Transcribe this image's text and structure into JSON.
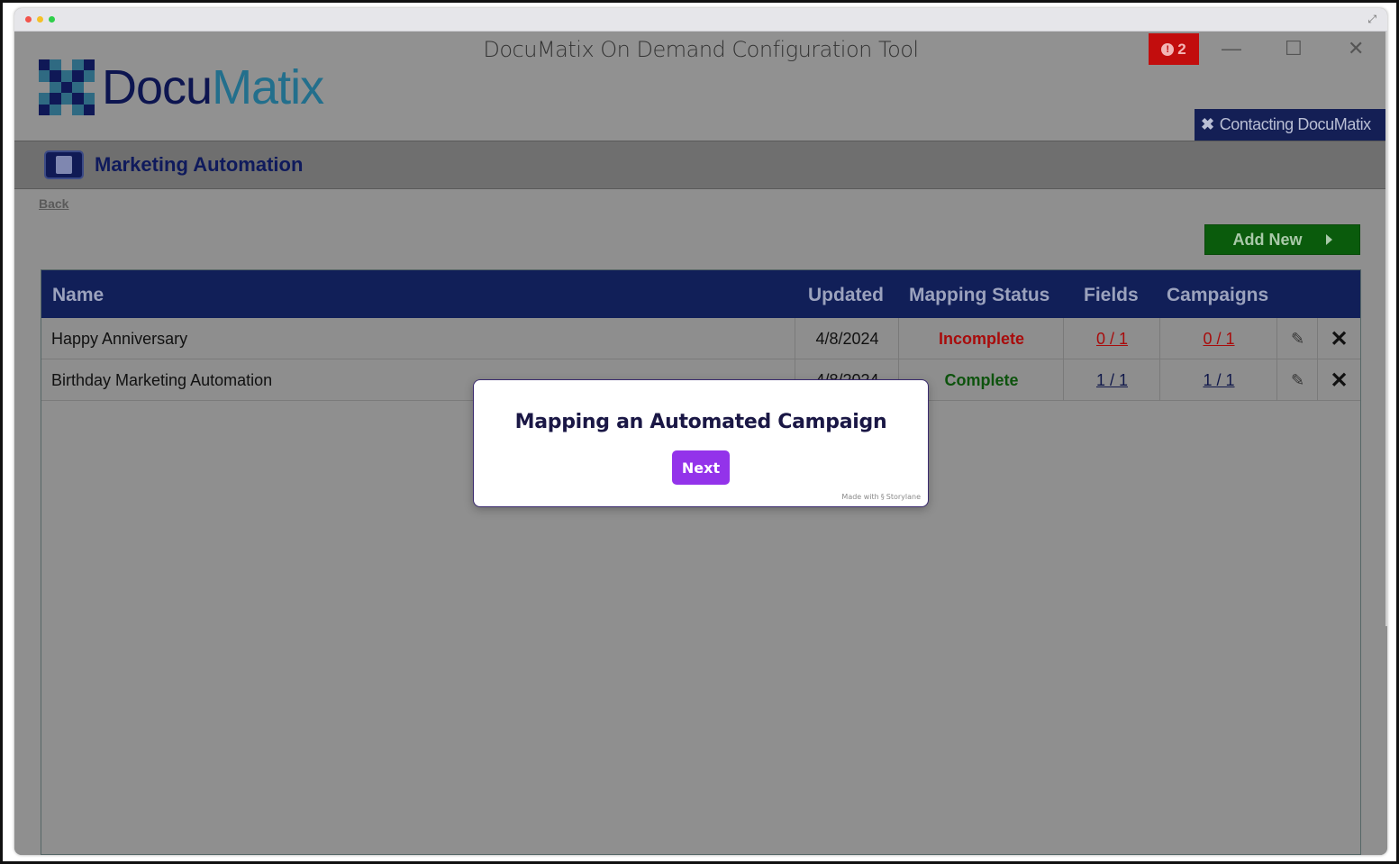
{
  "window": {
    "title": "DocuMatix On Demand Configuration Tool",
    "alert_count": "2"
  },
  "logo": {
    "docu": "Docu",
    "matix": "Matix"
  },
  "header": {
    "contact_label": "Contacting DocuMatix"
  },
  "section": {
    "title": "Marketing Automation"
  },
  "nav": {
    "back_label": "Back"
  },
  "toolbar": {
    "add_new_label": "Add New"
  },
  "table": {
    "columns": {
      "name": "Name",
      "updated": "Updated",
      "mapping_status": "Mapping Status",
      "fields": "Fields",
      "campaigns": "Campaigns"
    },
    "rows": [
      {
        "name": "Happy Anniversary",
        "updated": "4/8/2024",
        "mapping_status": "Incomplete",
        "fields": "0 / 1",
        "campaigns": "0 / 1"
      },
      {
        "name": "Birthday Marketing Automation",
        "updated": "4/8/2024",
        "mapping_status": "Complete",
        "fields": "1 / 1",
        "campaigns": "1 / 1"
      }
    ]
  },
  "modal": {
    "title": "Mapping an Automated Campaign",
    "next_label": "Next",
    "made_with": "Made with",
    "brand": "Storylane"
  },
  "colors": {
    "navy": "#111f58",
    "add_green": "#0a5b0c",
    "incomplete_red": "#a80c0c",
    "complete_green": "#0d530d",
    "next_purple": "#9333ea",
    "alert_red": "#c20d0d"
  },
  "icons": [
    "expand-icon",
    "alert-icon",
    "minimize-icon",
    "maximize-icon",
    "close-icon",
    "section-icon",
    "chevron-right-icon",
    "edit-pencil-icon",
    "delete-x-icon"
  ]
}
